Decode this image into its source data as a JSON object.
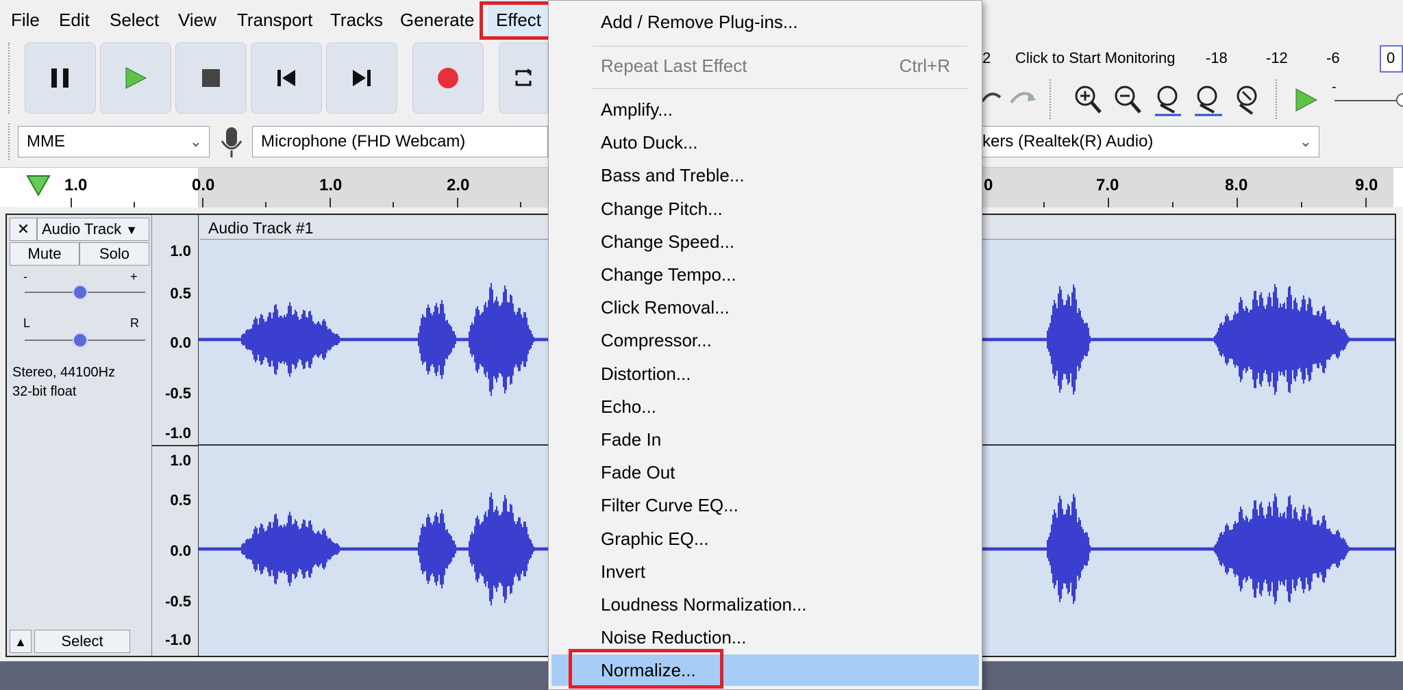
{
  "menubar": {
    "file": "File",
    "edit": "Edit",
    "select": "Select",
    "view": "View",
    "transport": "Transport",
    "tracks": "Tracks",
    "generate": "Generate",
    "effect": "Effect"
  },
  "meter": {
    "left_partial": "2",
    "monitor_text": "Click to Start Monitoring",
    "ticks": [
      "-18",
      "-12",
      "-6",
      "0"
    ]
  },
  "devices": {
    "host": "MME",
    "input": "Microphone (FHD Webcam)",
    "output_partial": "kers (Realtek(R) Audio)"
  },
  "ruler": {
    "labels_left": [
      "1.0",
      "0.0",
      "1.0",
      "2.0"
    ],
    "labels_right": [
      "0",
      "7.0",
      "8.0",
      "9.0"
    ]
  },
  "track": {
    "menu_label": "Audio Track",
    "mute": "Mute",
    "solo": "Solo",
    "gain_minus": "-",
    "gain_plus": "+",
    "pan_l": "L",
    "pan_r": "R",
    "format_rate": "Stereo, 44100Hz",
    "format_bits": "32-bit float",
    "select": "Select",
    "name": "Audio Track #1",
    "scale_top": [
      "1.0",
      "0.5",
      "0.0",
      "-0.5",
      "-1.0"
    ],
    "scale_bottom": [
      "1.0",
      "0.5",
      "0.0",
      "-0.5",
      "-1.0"
    ]
  },
  "effect_menu": {
    "add_remove": "Add / Remove Plug-ins...",
    "repeat": "Repeat Last Effect",
    "repeat_shortcut": "Ctrl+R",
    "items": [
      "Amplify...",
      "Auto Duck...",
      "Bass and Treble...",
      "Change Pitch...",
      "Change Speed...",
      "Change Tempo...",
      "Click Removal...",
      "Compressor...",
      "Distortion...",
      "Echo...",
      "Fade In",
      "Fade Out",
      "Filter Curve EQ...",
      "Graphic EQ...",
      "Invert",
      "Loudness Normalization...",
      "Noise Reduction...",
      "Normalize..."
    ],
    "selected": "Normalize..."
  },
  "colors": {
    "wave": "#3a3fcf",
    "highlight": "#e0202a",
    "selected_bg": "#a7cdf6"
  }
}
